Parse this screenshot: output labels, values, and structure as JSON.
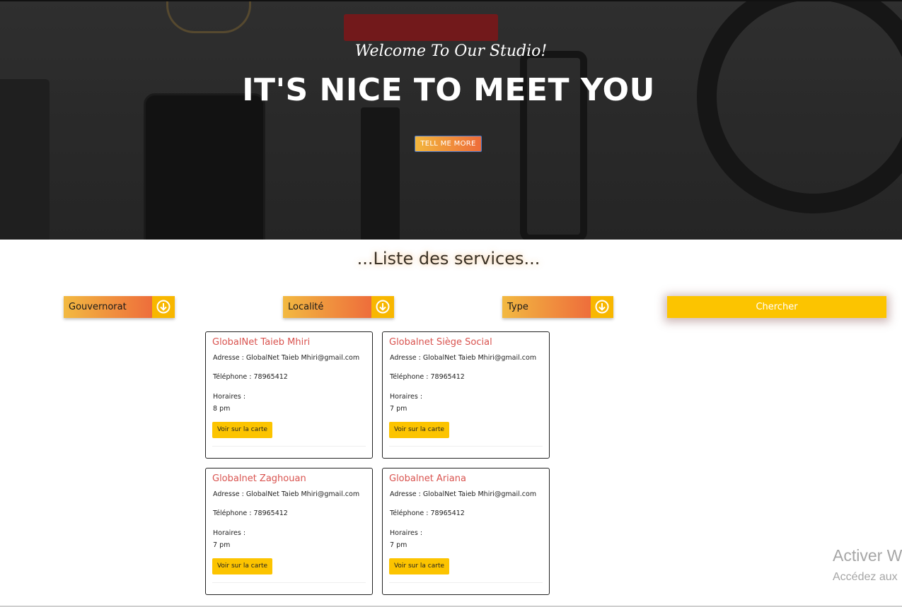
{
  "hero": {
    "subtitle": "Welcome To Our Studio!",
    "title": "IT'S NICE TO MEET YOU",
    "button_label": "TELL ME MORE"
  },
  "section": {
    "title": "...Liste des services..."
  },
  "filters": {
    "gouvernorat": "Gouvernorat",
    "localite": "Localité",
    "type": "Type",
    "search_label": "Chercher"
  },
  "cards": [
    {
      "name": "GlobalNet Taieb Mhiri",
      "address": "Adresse : GlobalNet Taieb Mhiri@gmail.com",
      "phone": "Téléphone : 78965412",
      "hours_label": "Horaires :",
      "hours": "8 pm",
      "button": "Voir sur la carte"
    },
    {
      "name": "Globalnet Siège Social",
      "address": "Adresse : GlobalNet Taieb Mhiri@gmail.com",
      "phone": "Téléphone : 78965412",
      "hours_label": "Horaires :",
      "hours": "7 pm",
      "button": "Voir sur la carte"
    },
    {
      "name": "Globalnet Zaghouan",
      "address": "Adresse : GlobalNet Taieb Mhiri@gmail.com",
      "phone": "Téléphone : 78965412",
      "hours_label": "Horaires :",
      "hours": "7 pm",
      "button": "Voir sur la carte"
    },
    {
      "name": "Globalnet Ariana",
      "address": "Adresse : GlobalNet Taieb Mhiri@gmail.com",
      "phone": "Téléphone : 78965412",
      "hours_label": "Horaires :",
      "hours": "7 pm",
      "button": "Voir sur la carte"
    }
  ],
  "watermark": {
    "line1": "Activer W",
    "line2": "Accédez aux"
  },
  "colors": {
    "accent_yellow": "#fcc400",
    "gradient_start": "#f2b941",
    "gradient_end": "#ee6d3b",
    "card_title": "#d9534f"
  },
  "icons": {
    "filter_arrow": "arrow-down-circle-icon"
  }
}
